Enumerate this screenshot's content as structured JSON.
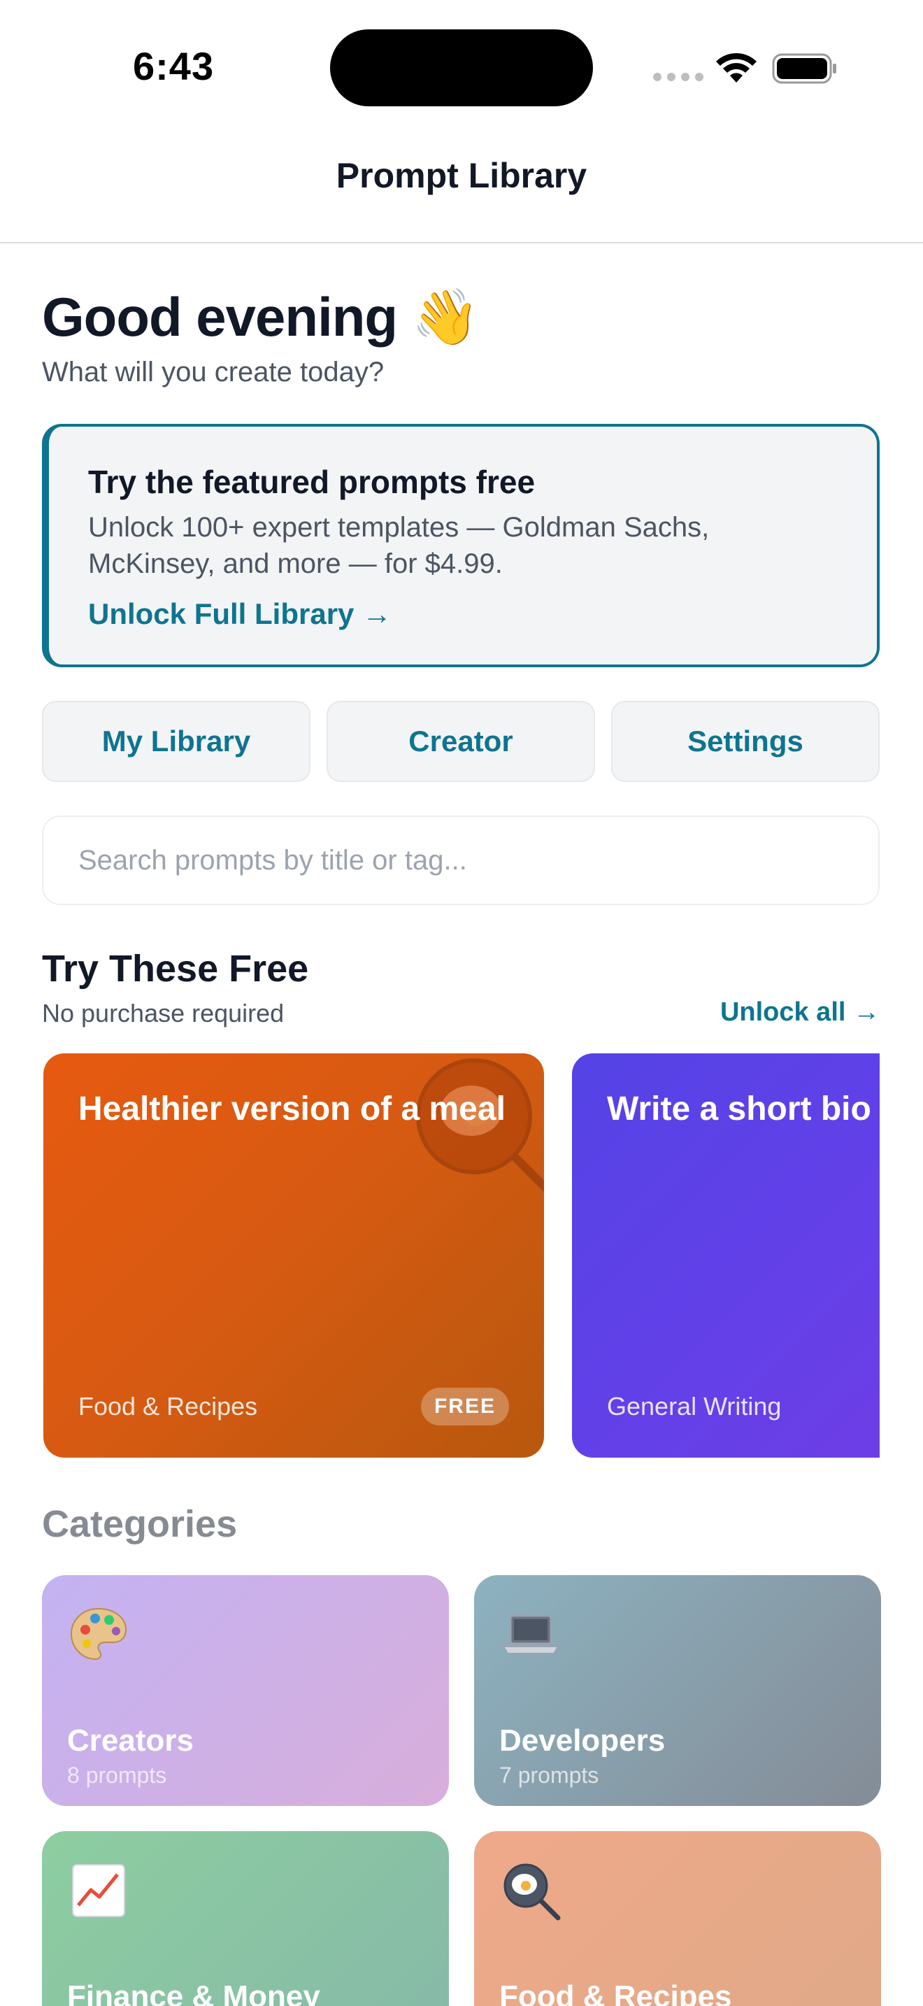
{
  "status_bar": {
    "time": "6:43"
  },
  "nav": {
    "title": "Prompt Library"
  },
  "greeting": {
    "title": "Good evening 👋",
    "subtitle": "What will you create today?"
  },
  "promo": {
    "title": "Try the featured prompts free",
    "body": "Unlock 100+ expert templates — Goldman Sachs, McKinsey, and more — for $4.99.",
    "link": "Unlock Full Library →"
  },
  "segments": [
    {
      "label": "My Library"
    },
    {
      "label": "Creator"
    },
    {
      "label": "Settings"
    }
  ],
  "search": {
    "placeholder": "Search prompts by title or tag...",
    "value": ""
  },
  "free_section": {
    "title": "Try These Free",
    "subtitle": "No purchase required",
    "link": "Unlock all →",
    "cards": [
      {
        "title": "Healthier version of a meal",
        "category": "Food & Recipes",
        "badge": "FREE",
        "icon": "frying-pan-icon",
        "color": "#e65a10"
      },
      {
        "title": "Write a short bio",
        "category": "General Writing",
        "color": "#5b43e6"
      }
    ]
  },
  "categories": {
    "heading": "Categories",
    "items": [
      {
        "name": "Creators",
        "count": "8 prompts",
        "icon": "palette-icon"
      },
      {
        "name": "Developers",
        "count": "7 prompts",
        "icon": "laptop-icon"
      },
      {
        "name": "Finance & Money",
        "count": "",
        "icon": "chart-up-icon"
      },
      {
        "name": "Food & Recipes",
        "count": "",
        "icon": "frying-pan-icon"
      }
    ]
  },
  "colors": {
    "accent": "#0e7490",
    "text": "#111827",
    "muted": "#4b5563"
  }
}
